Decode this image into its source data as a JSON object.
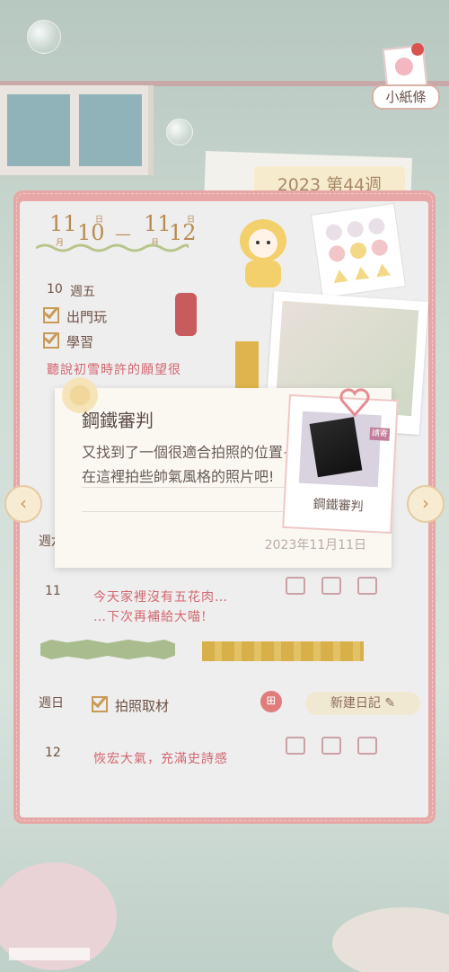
{
  "note_button": {
    "label": "小紙條"
  },
  "week_tab": {
    "label": "2023 第44週"
  },
  "date_range": {
    "start_month": "11",
    "start_day": "10",
    "start_month_unit": "月",
    "start_day_unit": "日",
    "end_month": "11",
    "end_day": "12",
    "end_month_unit": "月",
    "end_day_unit": "日",
    "dash": "—"
  },
  "entries": {
    "fri": {
      "date": "10",
      "weekday": "週五",
      "checks": [
        "出門玩",
        "學習"
      ],
      "text": "聽說初雪時許的願望很"
    },
    "sat": {
      "weekday": "週六",
      "date": "11",
      "text_line1": "今天家裡沒有五花肉…",
      "text_line2": "…下次再補給大喵!"
    },
    "sun": {
      "weekday": "週日",
      "date": "12",
      "checks": [
        "拍照取材"
      ],
      "text": "恢宏大氣，充滿史詩感",
      "new_button": "新建日記"
    }
  },
  "popup": {
    "title": "鋼鐵審判",
    "description": "又找到了一個很適合拍照的位置~在這裡拍些帥氣風格的照片吧!",
    "date": "2023年11月11日",
    "item": {
      "name": "鋼鐵審判",
      "tag": "請寄"
    }
  },
  "arrows": {
    "left": "‹",
    "right": "›"
  },
  "colors": {
    "journal_border": "#e6a7a6",
    "accent_gold": "#c99a55",
    "handwriting": "#d2666f"
  }
}
